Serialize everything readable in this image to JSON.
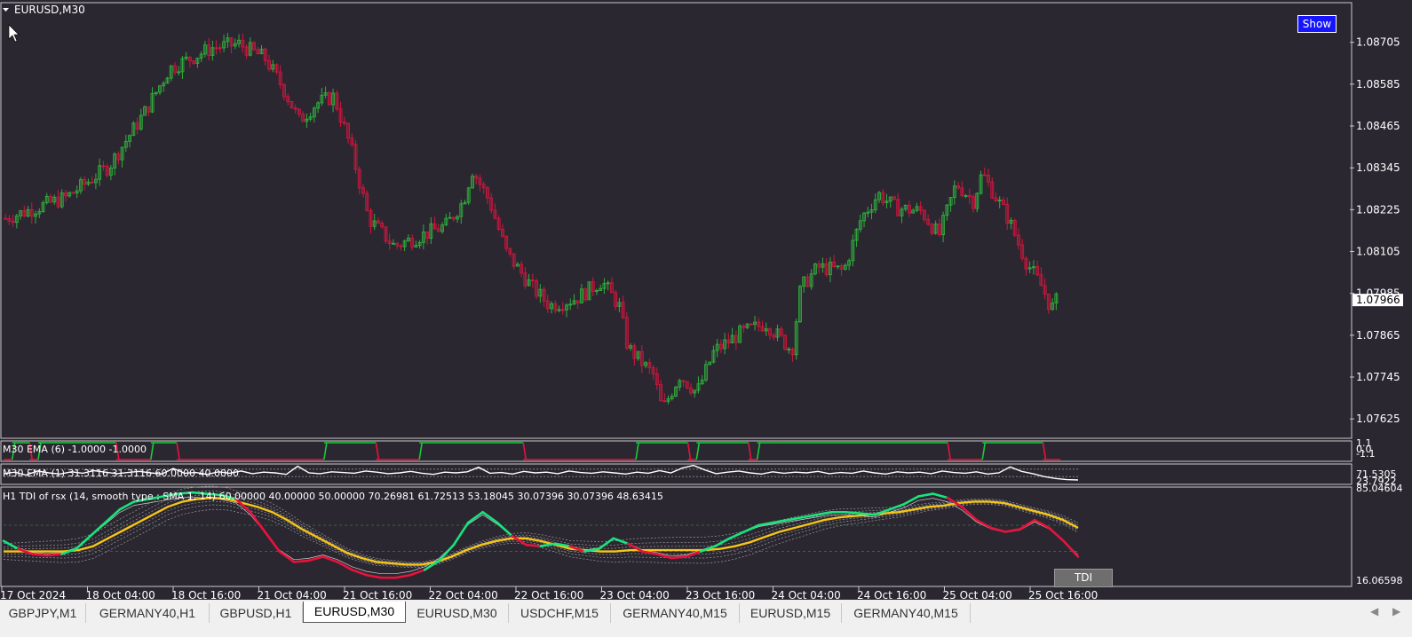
{
  "window": {
    "title": "EURUSD,M30"
  },
  "buttons": {
    "show": "Show",
    "tdi": "TDI"
  },
  "colors": {
    "background": "#2b2731",
    "bull_candle": "#2fae3c",
    "bear_candle": "#d0163d",
    "tdi_up": "#19e37c",
    "tdi_down": "#e8123c",
    "signal": "#f5c518",
    "band": "#9a9a9a",
    "ema_up": "#19c93b",
    "ema_down": "#e8123c"
  },
  "chart_data": [
    {
      "type": "candlestick",
      "title": "EURUSD,M30",
      "y_ticks": [
        "1.08705",
        "1.08585",
        "1.08465",
        "1.08345",
        "1.08225",
        "1.08105",
        "1.07985",
        "1.07865",
        "1.07745",
        "1.07625"
      ],
      "ylim": [
        1.076,
        1.0875
      ],
      "current_price": "1.07966",
      "x_ticks": [
        "17 Oct 2024",
        "18 Oct 04:00",
        "18 Oct 16:00",
        "21 Oct 04:00",
        "21 Oct 16:00",
        "22 Oct 04:00",
        "22 Oct 16:00",
        "23 Oct 04:00",
        "23 Oct 16:00",
        "24 Oct 04:00",
        "24 Oct 16:00",
        "25 Oct 04:00",
        "25 Oct 16:00"
      ],
      "close_path": [
        [
          0,
          1.082
        ],
        [
          7,
          1.0826
        ],
        [
          12,
          1.0835
        ],
        [
          16,
          1.085
        ],
        [
          19,
          1.0863
        ],
        [
          24,
          1.0869
        ],
        [
          27,
          1.087
        ],
        [
          30,
          1.0866
        ],
        [
          32,
          1.0858
        ],
        [
          34,
          1.0848
        ],
        [
          36,
          1.0853
        ],
        [
          38,
          1.0855
        ],
        [
          40,
          1.084
        ],
        [
          42,
          1.082
        ],
        [
          45,
          1.0812
        ],
        [
          48,
          1.0815
        ],
        [
          51,
          1.0818
        ],
        [
          53,
          1.0825
        ],
        [
          54,
          1.0834
        ],
        [
          56,
          1.0825
        ],
        [
          58,
          1.081
        ],
        [
          61,
          1.08
        ],
        [
          63,
          1.0795
        ],
        [
          66,
          1.0797
        ],
        [
          69,
          1.0802
        ],
        [
          71,
          1.0795
        ],
        [
          72,
          1.0783
        ],
        [
          75,
          1.0775
        ],
        [
          76,
          1.0765
        ],
        [
          78,
          1.0775
        ],
        [
          80,
          1.077
        ],
        [
          82,
          1.0782
        ],
        [
          85,
          1.0787
        ],
        [
          88,
          1.079
        ],
        [
          91,
          1.0782
        ],
        [
          92,
          1.08
        ],
        [
          94,
          1.0806
        ],
        [
          97,
          1.0805
        ],
        [
          99,
          1.082
        ],
        [
          101,
          1.0827
        ],
        [
          103,
          1.0823
        ],
        [
          106,
          1.0822
        ],
        [
          108,
          1.0815
        ],
        [
          110,
          1.083
        ],
        [
          112,
          1.0825
        ],
        [
          113,
          1.0833
        ],
        [
          116,
          1.082
        ],
        [
          118,
          1.0808
        ],
        [
          120,
          1.08
        ],
        [
          121,
          1.0794
        ],
        [
          122,
          1.0798
        ]
      ]
    },
    {
      "type": "line",
      "title": "M30 EMA (6) -1.0000 -1.0000",
      "y_ticks": [
        "1.1",
        "0.0",
        "-1.1"
      ],
      "ylim": [
        -1.1,
        1.1
      ],
      "segments": [
        [
          0,
          1,
          -1
        ],
        [
          1,
          3,
          1
        ],
        [
          3,
          4,
          -1
        ],
        [
          4,
          5,
          1
        ],
        [
          5,
          13,
          1
        ],
        [
          13,
          17,
          -1
        ],
        [
          17,
          20,
          1
        ],
        [
          20,
          24,
          -1
        ],
        [
          24,
          26,
          -1
        ],
        [
          26,
          37,
          -1
        ],
        [
          37,
          43,
          1
        ],
        [
          43,
          48,
          -1
        ],
        [
          48,
          60,
          1
        ],
        [
          60,
          70,
          -1
        ],
        [
          70,
          73,
          -1
        ],
        [
          73,
          79,
          1
        ],
        [
          79,
          80,
          -1
        ],
        [
          80,
          86,
          1
        ],
        [
          86,
          87,
          -1
        ],
        [
          87,
          90,
          1
        ],
        [
          90,
          109,
          1
        ],
        [
          109,
          113,
          -1
        ],
        [
          113,
          120,
          1
        ],
        [
          120,
          122,
          -1
        ]
      ]
    },
    {
      "type": "line",
      "title": "M30 EMA (1) 31.3116 31.3116 60.0000 40.0000",
      "y_ticks": [
        "71.5305",
        "23.7922"
      ],
      "ylim": [
        23.7922,
        71.5305
      ],
      "levels": [
        60.0,
        40.0
      ],
      "series": [
        {
          "values": [
            48,
            52,
            44,
            55,
            50,
            47,
            53,
            49,
            56,
            52,
            48,
            51,
            54,
            50,
            47,
            62,
            49,
            51,
            46,
            53,
            49,
            55,
            48,
            52,
            50,
            46,
            68,
            50,
            48,
            53,
            51,
            49,
            55,
            52,
            48,
            50,
            54,
            49,
            46,
            52,
            50,
            53,
            65,
            49,
            51,
            47,
            54,
            50,
            52,
            48,
            55,
            51,
            49,
            53,
            50,
            47,
            52,
            49,
            56,
            50,
            63,
            70,
            58,
            48,
            52,
            55,
            50,
            47,
            53,
            49,
            52,
            50,
            54,
            48,
            51,
            49,
            55,
            50,
            47,
            53,
            50,
            52,
            48,
            55,
            51,
            49,
            53,
            47,
            50,
            66,
            54,
            48,
            40,
            35,
            32,
            31
          ]
        }
      ]
    },
    {
      "type": "line",
      "title": "H1  TDI of rsx  (14, smooth type :  SMA 1, 14) 60.00000 40.00000 50.00000 70.26981 61.72513 53.18045 30.07396 30.07396 48.63415",
      "y_ticks": [
        "85.04604",
        "16.06598"
      ],
      "ylim": [
        16.06598,
        85.04604
      ],
      "levels": [
        60.0,
        40.0
      ],
      "series": [
        {
          "name": "rsx",
          "values": [
            48,
            42,
            38,
            37,
            38,
            42,
            52,
            62,
            72,
            78,
            80,
            82,
            84,
            85,
            84,
            83,
            80,
            70,
            55,
            40,
            32,
            33,
            36,
            32,
            26,
            22,
            20,
            20,
            22,
            26,
            33,
            45,
            62,
            70,
            62,
            52,
            45,
            44,
            46,
            44,
            40,
            42,
            50,
            46,
            40,
            38,
            35,
            36,
            40,
            44,
            50,
            55,
            60,
            62,
            64,
            66,
            68,
            70,
            70,
            69,
            68,
            72,
            76,
            82,
            84,
            81,
            74,
            64,
            58,
            55,
            57,
            64,
            58,
            48,
            36
          ]
        },
        {
          "name": "signal",
          "values": [
            40,
            40,
            40,
            40,
            40,
            41,
            44,
            50,
            56,
            62,
            68,
            74,
            78,
            80,
            81,
            80,
            77,
            74,
            70,
            64,
            57,
            51,
            45,
            39,
            35,
            32,
            31,
            30,
            30,
            32,
            36,
            41,
            45,
            48,
            50,
            50,
            48,
            45,
            42,
            41,
            40,
            40,
            41,
            41,
            41,
            41,
            41,
            41,
            42,
            44,
            47,
            51,
            55,
            58,
            61,
            64,
            66,
            67,
            68,
            69,
            70,
            72,
            74,
            75,
            77,
            78,
            78,
            77,
            74,
            71,
            68,
            64,
            58
          ]
        }
      ]
    }
  ],
  "tabs": [
    {
      "label": "GBPJPY,M1"
    },
    {
      "label": "GERMANY40,H1"
    },
    {
      "label": "GBPUSD,H1"
    },
    {
      "label": "EURUSD,M30",
      "active": true
    },
    {
      "label": "EURUSD,M30"
    },
    {
      "label": "USDCHF,M15"
    },
    {
      "label": "GERMANY40,M15"
    },
    {
      "label": "EURUSD,M15"
    },
    {
      "label": "GERMANY40,M15"
    }
  ],
  "tab_scroll": {
    "left": "◀",
    "right": "▶"
  }
}
